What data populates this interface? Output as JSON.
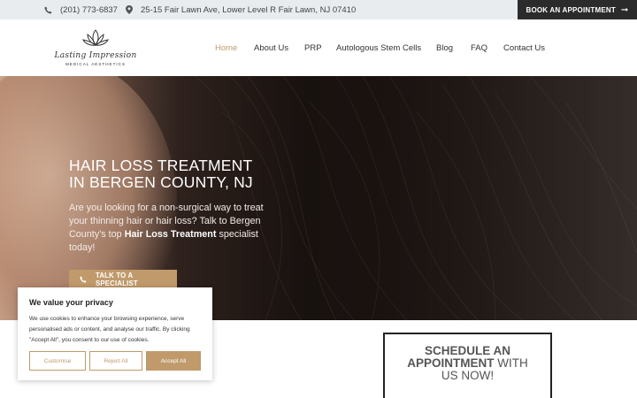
{
  "topbar": {
    "phone": "(201) 773-6837",
    "address": "25-15 Fair Lawn Ave, Lower Level R Fair Lawn, NJ 07410",
    "book_label": "BOOK AN APPOINTMENT"
  },
  "logo": {
    "script": "Lasting Impression",
    "sub": "MEDICAL AESTHETICS"
  },
  "nav": {
    "items": [
      "Home",
      "About Us",
      "PRP",
      "Autologous Stem Cells",
      "Blog",
      "FAQ",
      "Contact Us"
    ],
    "active": "Home"
  },
  "hero": {
    "title_line1": "HAIR LOSS TREATMENT",
    "title_line2": "IN BERGEN COUNTY, NJ",
    "text_before": "Are you looking for a non-surgical way to treat your thinning hair or hair loss? Talk to Bergen County's top ",
    "text_bold": "Hair Loss Treatment",
    "text_after": " specialist today!",
    "cta_label": "TALK TO A SPECIALIST"
  },
  "schedule": {
    "line1": "SCHEDULE AN",
    "line2_bold": "APPOINTMENT",
    "line2_rest": " WITH",
    "line3": "US NOW!"
  },
  "cookie": {
    "title": "We value your privacy",
    "text": "We use cookies to enhance your browsing experience, serve personalised ads or content, and analyse our traffic. By clicking \"Accept All\", you consent to our use of cookies.",
    "customise": "Customise",
    "reject": "Reject All",
    "accept": "Accept All"
  },
  "colors": {
    "accent": "#c09a6b",
    "dark": "#2b2b2b",
    "topbar_bg": "#e9ecef"
  },
  "icons": [
    "phone-icon",
    "map-pin-icon",
    "arrow-right-icon",
    "lotus-logo-icon"
  ]
}
